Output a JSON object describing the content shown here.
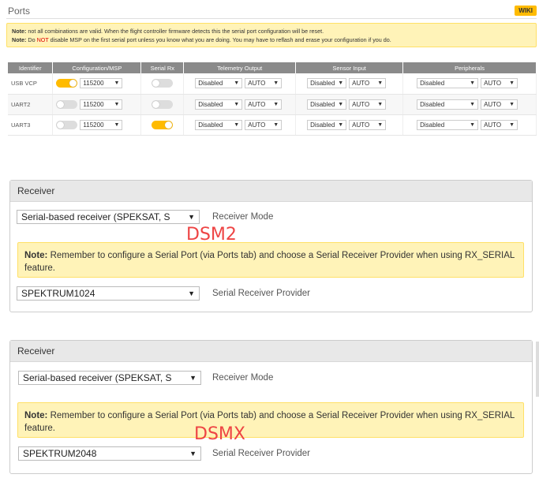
{
  "ports": {
    "title": "Ports",
    "wiki_label": "WIKI",
    "note1_prefix": "Note:",
    "note1_text": " not all combinations are valid. When the flight controller firmware detects this the serial port configuration will be reset.",
    "note2_prefix": "Note:",
    "note2_pre": " Do ",
    "note2_not": "NOT",
    "note2_post": " disable MSP on the first serial port unless you know what you are doing. You may have to reflash and erase your configuration if you do.",
    "columns": [
      "Identifier",
      "Configuration/MSP",
      "Serial Rx",
      "Telemetry Output",
      "Sensor Input",
      "Peripherals"
    ],
    "rows": [
      {
        "id": "USB VCP",
        "msp_on": true,
        "baud": "115200",
        "serial_rx_on": false,
        "telemetry": "Disabled",
        "telemetry_baud": "AUTO",
        "sensor": "Disabled",
        "sensor_baud": "AUTO",
        "peripheral": "Disabled",
        "peripheral_baud": "AUTO"
      },
      {
        "id": "UART2",
        "msp_on": false,
        "baud": "115200",
        "serial_rx_on": false,
        "telemetry": "Disabled",
        "telemetry_baud": "AUTO",
        "sensor": "Disabled",
        "sensor_baud": "AUTO",
        "peripheral": "Disabled",
        "peripheral_baud": "AUTO"
      },
      {
        "id": "UART3",
        "msp_on": false,
        "baud": "115200",
        "serial_rx_on": true,
        "telemetry": "Disabled",
        "telemetry_baud": "AUTO",
        "sensor": "Disabled",
        "sensor_baud": "AUTO",
        "peripheral": "Disabled",
        "peripheral_baud": "AUTO"
      }
    ]
  },
  "receiver1": {
    "title": "Receiver",
    "mode_value": "Serial-based receiver (SPEKSAT, S",
    "mode_label": "Receiver Mode",
    "note_prefix": "Note:",
    "note_text": " Remember to configure a Serial Port (via Ports tab) and choose a Serial Receiver Provider when using RX_SERIAL feature.",
    "provider_value": "SPEKTRUM1024",
    "provider_label": "Serial Receiver Provider",
    "annotation": "DSM2"
  },
  "receiver2": {
    "title": "Receiver",
    "mode_value": "Serial-based receiver (SPEKSAT, S",
    "mode_label": "Receiver Mode",
    "note_prefix": "Note:",
    "note_text": " Remember to configure a Serial Port (via Ports tab) and choose a Serial Receiver Provider when using RX_SERIAL feature.",
    "provider_value": "SPEKTRUM2048",
    "provider_label": "Serial Receiver Provider",
    "annotation": "DSMX"
  },
  "icons": {
    "dropdown_arrow": "▼"
  },
  "colors": {
    "accent": "#ffbb00",
    "note_bg": "#fff3b8",
    "annotation": "#ee4444"
  }
}
